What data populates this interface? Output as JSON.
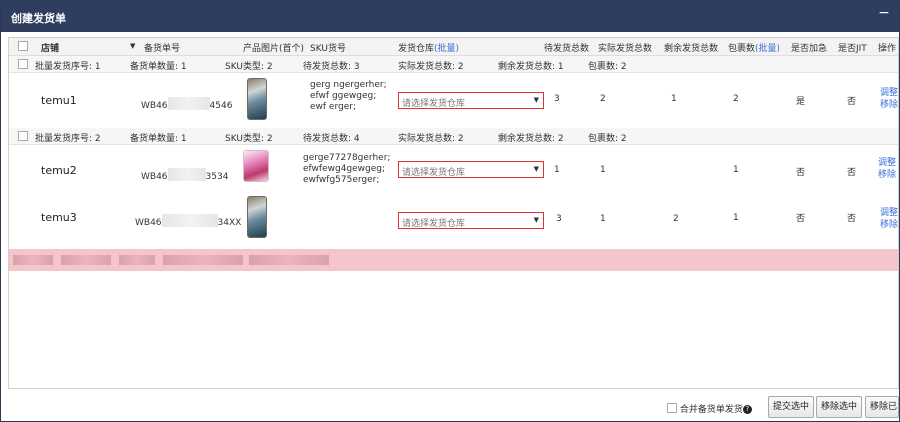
{
  "dialog": {
    "title": "创建发货单",
    "minimize": "−"
  },
  "header": {
    "store": "店铺",
    "order_no": "备货单号",
    "product_image": "产品图片(首个)",
    "sku_no": "SKU货号",
    "warehouse": "发货仓库",
    "warehouse_batch": "(批量)",
    "pending_total": "待发货总数",
    "actual_total": "实际发货总数",
    "remaining_total": "剩余发货总数",
    "package_count": "包裹数",
    "package_batch": "(批量)",
    "urgent": "是否加急",
    "jit": "是否JIT",
    "action": "操作"
  },
  "groups": [
    {
      "batch_seq": "批量发货序号: 1",
      "order_count": "备货单数量: 1",
      "sku_types": "SKU类型: 2",
      "pending": "待发货总数: 3",
      "actual": "实际发货总数: 2",
      "remaining": "剩余发货总数: 1",
      "packages": "包裹数: 2"
    },
    {
      "batch_seq": "批量发货序号: 2",
      "order_count": "备货单数量: 1",
      "sku_types": "SKU类型: 2",
      "pending": "待发货总数: 4",
      "actual": "实际发货总数: 2",
      "remaining": "剩余发货总数: 2",
      "packages": "包裹数: 2"
    }
  ],
  "rows": [
    {
      "store": "temu1",
      "order_prefix": "WB46",
      "order_suffix": "4546",
      "sku": [
        "gerg   ngergerher;",
        "efwf    ggewgeg;",
        "ewf      erger;"
      ],
      "warehouse_placeholder": "请选择发货仓库",
      "pending": "3",
      "actual": "2",
      "remaining": "1",
      "packages": "2",
      "urgent": "是",
      "jit": "否",
      "action1": "调整",
      "action2": "移除"
    },
    {
      "store": "temu2",
      "order_prefix": "WB46",
      "order_suffix": "3534",
      "sku": [
        "gerge77278gerher;",
        "efwfewg4gewgeg;",
        "ewfwfg575erger;"
      ],
      "warehouse_placeholder": "请选择发货仓库",
      "pending": "1",
      "actual": "1",
      "remaining": "",
      "packages": "1",
      "urgent": "否",
      "jit": "否",
      "action1": "调整",
      "action2": "移除"
    },
    {
      "store": "temu3",
      "order_prefix": "WB46",
      "order_suffix": "34XX",
      "sku": [],
      "warehouse_placeholder": "请选择发货仓库",
      "pending": "3",
      "actual": "1",
      "remaining": "2",
      "packages": "1",
      "urgent": "否",
      "jit": "否",
      "action1": "调整",
      "action2": "移除"
    }
  ],
  "footer": {
    "merge_label": "合并备货单发货",
    "help": "?",
    "submit_selected": "提交选中",
    "remove_selected": "移除选中",
    "remove_partial": "移除已"
  }
}
